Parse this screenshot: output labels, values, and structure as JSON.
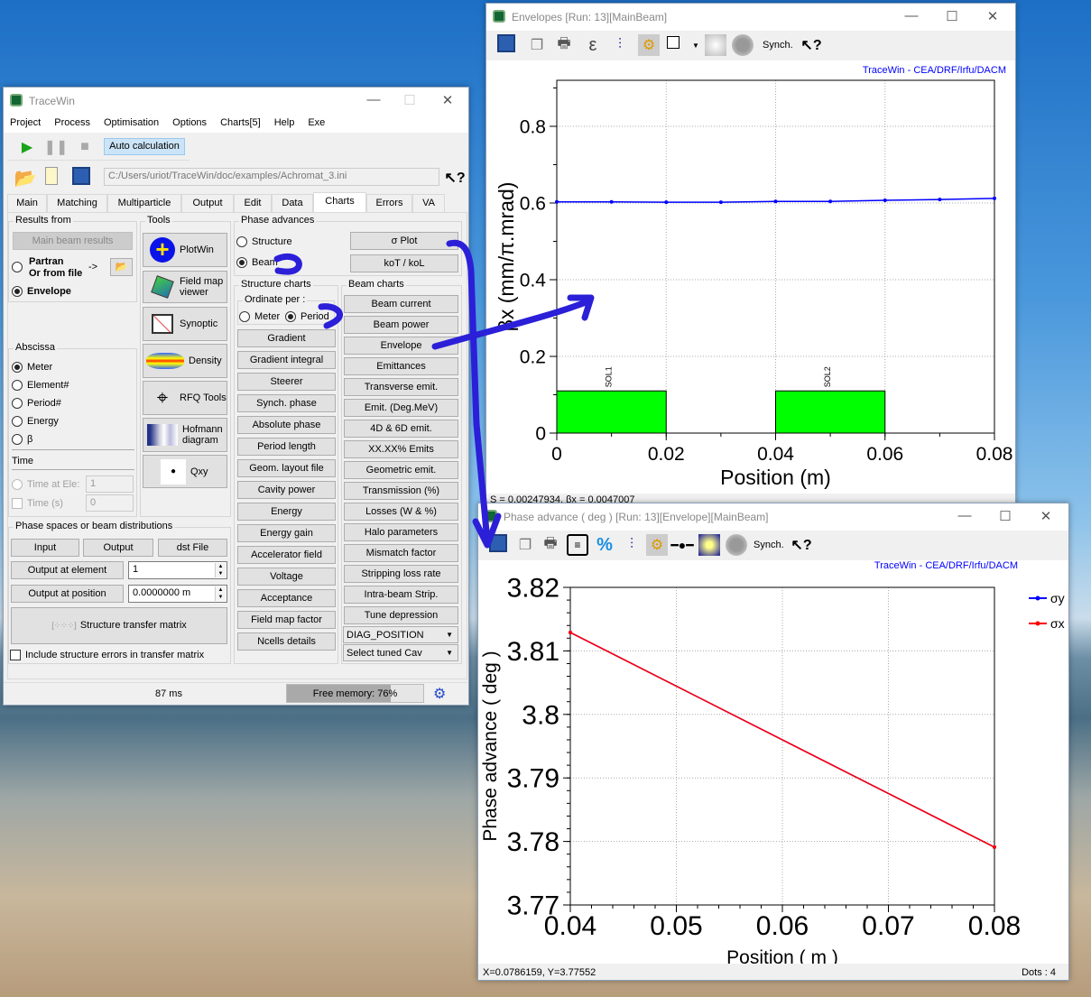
{
  "tracewin": {
    "title": "TraceWin",
    "menu": [
      "Project",
      "Process",
      "Optimisation",
      "Options",
      "Charts[5]",
      "Help",
      "Exe"
    ],
    "auto_calc": "Auto calculation",
    "path": "C:/Users/uriot/TraceWin/doc/examples/Achromat_3.ini",
    "tabs": [
      "Main",
      "Matching",
      "Multiparticle",
      "Output",
      "Edit",
      "Data",
      "Charts",
      "Errors",
      "VA"
    ],
    "active_tab": "Charts",
    "results_from": {
      "label": "Results from",
      "main_beam": "Main beam results",
      "partran": "Partran\nOr from file",
      "arrow": "->",
      "envelope": "Envelope",
      "selected": "Envelope"
    },
    "abscissa": {
      "label": "Abscissa",
      "options": [
        "Meter",
        "Element#",
        "Period#",
        "Energy",
        "β"
      ],
      "selected": "Meter",
      "time_label": "Time",
      "time_at_ele": "Time at Ele:",
      "time_at_ele_value": "1",
      "time_s": "Time (s)",
      "time_s_value": "0"
    },
    "tools": {
      "label": "Tools",
      "items": [
        "PlotWin",
        "Field map viewer",
        "Synoptic",
        "Density",
        "RFQ Tools",
        "Hofmann diagram",
        "Qxy"
      ]
    },
    "phase_advances": {
      "label": "Phase advances",
      "structure": "Structure",
      "beam": "Beam",
      "selected": "Beam",
      "sigma_plot": "σ Plot",
      "kot": "koT / koL"
    },
    "structure_charts": {
      "label": "Structure charts",
      "ordinate_label": "Ordinate per :",
      "meter": "Meter",
      "period": "Period",
      "selected": "Period",
      "buttons": [
        "Gradient",
        "Gradient integral",
        "Steerer",
        "Synch. phase",
        "Absolute phase",
        "Period length",
        "Geom. layout file",
        "Cavity power",
        "Energy",
        "Energy gain",
        "Accelerator field",
        "Voltage",
        "Acceptance",
        "Field map factor",
        "Ncells details"
      ]
    },
    "beam_charts": {
      "label": "Beam charts",
      "buttons": [
        "Beam current",
        "Beam power",
        "Envelope",
        "Emittances",
        "Transverse emit.",
        "Emit. (Deg.MeV)",
        "4D & 6D emit.",
        "XX.XX% Emits",
        "Geometric emit.",
        "Transmission (%)",
        "Losses (W & %)",
        "Halo parameters",
        "Mismatch factor",
        "Stripping loss rate",
        "Intra-beam Strip.",
        "Tune depression"
      ],
      "diag_select": "DIAG_POSITION",
      "cav_select": "Select tuned Cav"
    },
    "phase_spaces": {
      "label": "Phase spaces or beam distributions",
      "input": "Input",
      "output": "Output",
      "dst": "dst File",
      "output_at_element": "Output at element",
      "element_value": "1",
      "output_at_position": "Output at position",
      "position_value": "0.0000000 m",
      "transfer_matrix": "Structure transfer matrix",
      "include_errors": "Include structure errors in transfer matrix"
    },
    "status": {
      "time": "87 ms",
      "memory": "Free memory: 76%",
      "memory_percent": 76
    }
  },
  "envelopes_window": {
    "title": "Envelopes [Run: 13][MainBeam]",
    "synch": "Synch.",
    "credit": "TraceWin - CEA/DRF/Irfu/DACM",
    "status": "S = 0.00247934, βx = 0.0047007"
  },
  "phase_window": {
    "title": "Phase advance ( deg ) [Run: 13][Envelope][MainBeam]",
    "synch": "Synch.",
    "credit": "TraceWin - CEA/DRF/Irfu/DACM",
    "status": "X=0.0786159, Y=3.77552",
    "dots": "Dots : 4"
  },
  "chart_data": [
    {
      "type": "line",
      "xlabel": "Position (m)",
      "ylabel": "βx (mm/π.mrad)",
      "xlim": [
        0,
        0.08
      ],
      "ylim": [
        0,
        0.92
      ],
      "xticks": [
        "0",
        "0.02",
        "0.04",
        "0.06",
        "0.08"
      ],
      "yticks": [
        "0",
        "0.2",
        "0.4",
        "0.6",
        "0.8"
      ],
      "grid": true,
      "series": [
        {
          "color": "#0000ff",
          "x": [
            0,
            0.01,
            0.02,
            0.03,
            0.04,
            0.05,
            0.06,
            0.07,
            0.08
          ],
          "y": [
            0.603,
            0.603,
            0.602,
            0.602,
            0.604,
            0.604,
            0.607,
            0.609,
            0.612
          ]
        }
      ],
      "elements": [
        {
          "name": "SOL1",
          "x0": 0,
          "x1": 0.02,
          "height": 0.11,
          "color": "#00ff00"
        },
        {
          "name": "SOL2",
          "x0": 0.04,
          "x1": 0.06,
          "height": 0.11,
          "color": "#00ff00"
        }
      ]
    },
    {
      "type": "line",
      "xlabel": "Position ( m )",
      "ylabel": "Phase advance ( deg )",
      "xlim": [
        0.04,
        0.08
      ],
      "ylim": [
        3.77,
        3.82
      ],
      "xticks": [
        "0.04",
        "0.05",
        "0.06",
        "0.07",
        "0.08"
      ],
      "yticks": [
        "3.77",
        "3.78",
        "3.79",
        "3.8",
        "3.81",
        "3.82"
      ],
      "grid": true,
      "legend": "top-right",
      "series": [
        {
          "name": "σy",
          "color": "#0000ff",
          "x": [
            0.04,
            0.08
          ],
          "y": [
            3.8129,
            3.7791
          ]
        },
        {
          "name": "σx",
          "color": "#ff0000",
          "x": [
            0.04,
            0.08
          ],
          "y": [
            3.8129,
            3.7791
          ]
        }
      ]
    }
  ],
  "colors": {
    "annotation": "#2b1fd8",
    "accent": "#0000ff",
    "grid": "#aaaaaa"
  }
}
